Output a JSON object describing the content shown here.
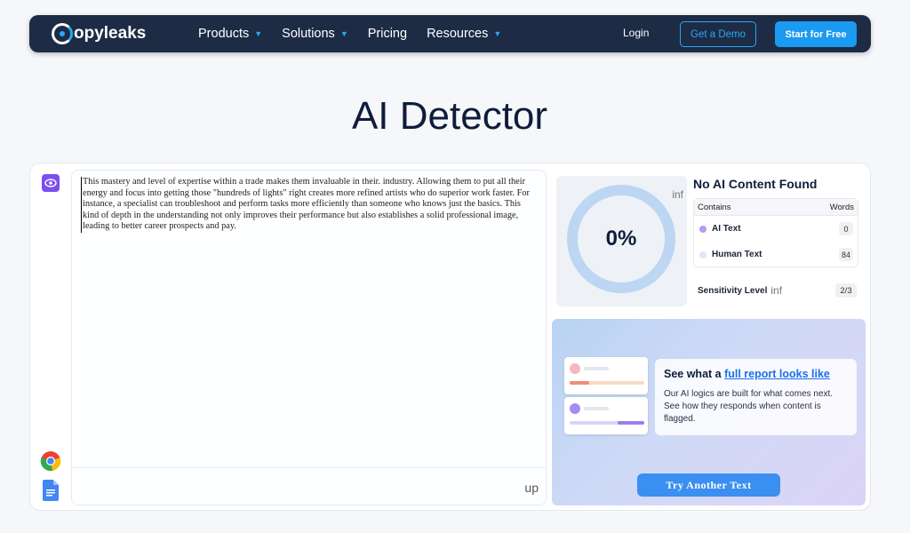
{
  "nav": {
    "brand": "opyleaks",
    "items": [
      {
        "label": "Products",
        "has_caret": true
      },
      {
        "label": "Solutions",
        "has_caret": true
      },
      {
        "label": "Pricing",
        "has_caret": false
      },
      {
        "label": "Resources",
        "has_caret": true
      }
    ],
    "login": "Login",
    "demo": "Get a Demo",
    "start": "Start for Free"
  },
  "page": {
    "title": "AI Detector"
  },
  "editor": {
    "text": "This mastery and level of expertise within a trade makes them invaluable in their. industry. Allowing them to put all their energy and focus into getting those \"hundreds of lights\" right creates more refined artists who do superior work faster. For instance, a specialist can troubleshoot and perform tasks more efficiently than someone who knows just the basics. This kind of depth in the understanding not only improves their performance but also establishes a solid professional image, leading to better career prospects and pay.",
    "upload_label": "up"
  },
  "result": {
    "percent": "0%",
    "info_glyph": "inf",
    "title": "No AI Content Found",
    "table_head": {
      "contains": "Contains",
      "words": "Words"
    },
    "rows": [
      {
        "label": "AI Text",
        "count": "0",
        "color": "#b59af0"
      },
      {
        "label": "Human Text",
        "count": "84",
        "color": "#dde8f8"
      }
    ],
    "sensitivity_label": "Sensitivity Level",
    "sensitivity_value": "2/3"
  },
  "promo": {
    "heading_prefix": "See what a ",
    "heading_link": "full report looks like",
    "body": "Our AI logics are built for what comes next. See how they responds when content is flagged.",
    "button": "Try Another Text"
  },
  "colors": {
    "nav_bg": "#1d2b45",
    "accent": "#2aa8f5",
    "start_btn": "#1a9af0",
    "ai_purple": "#7b4ff0",
    "gauge": "#bcd6f3"
  }
}
